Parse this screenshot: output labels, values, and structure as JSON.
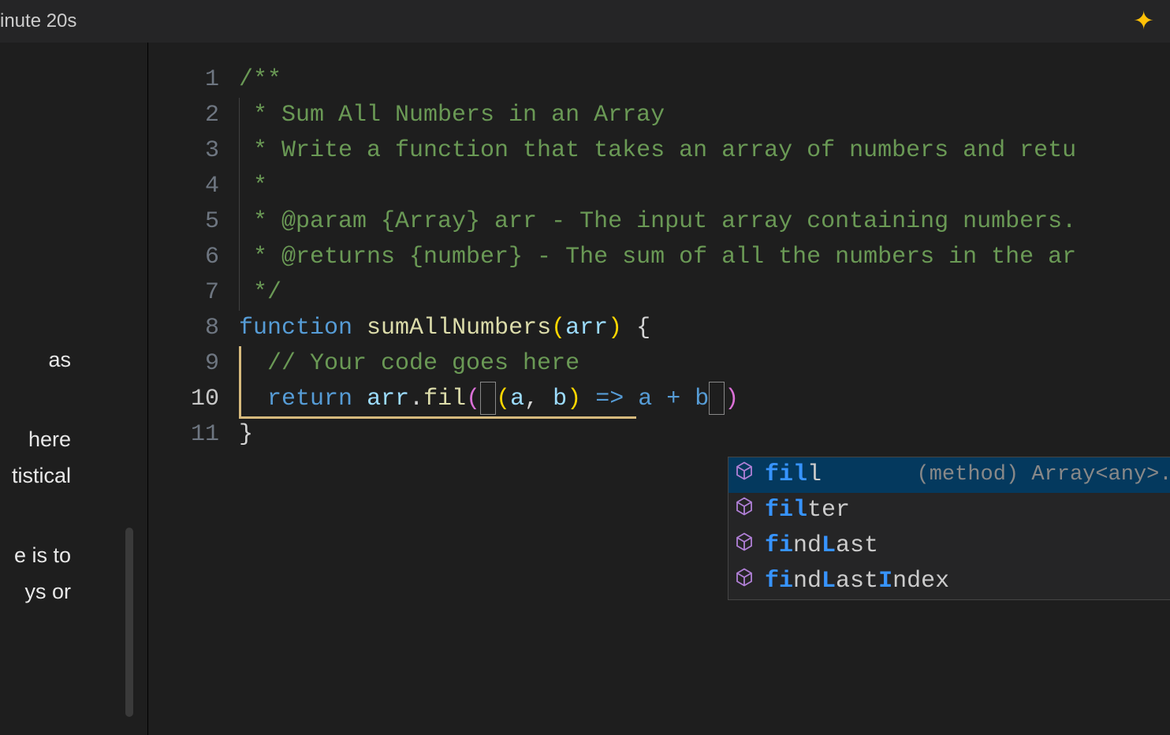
{
  "topbar": {
    "left_text": "inute 20s"
  },
  "left_panel": {
    "fragment1": "as",
    "fragment2": "here",
    "fragment3": "tistical",
    "fragment4": "e is to",
    "fragment5": "ys or"
  },
  "gutter": {
    "lines": [
      "1",
      "2",
      "3",
      "4",
      "5",
      "6",
      "7",
      "8",
      "9",
      "10",
      "11"
    ],
    "current_line": 10
  },
  "code": {
    "line1": "/**",
    "line2": " * Sum All Numbers in an Array",
    "line3": " * Write a function that takes an array of numbers and retu",
    "line4": " *",
    "line5": " * @param {Array} arr - The input array containing numbers.",
    "line6": " * @returns {number} - The sum of all the numbers in the ar",
    "line7": " */",
    "line8_kw": "function",
    "line8_fn": "sumAllNumbers",
    "line8_param": "arr",
    "line8_end": " {",
    "line9": "  // Your code goes here",
    "line10_kw": "return",
    "line10_obj": "arr",
    "line10_method": "fil",
    "line10_a": "a",
    "line10_b": "b",
    "line10_arrow_body": " => a + b",
    "line11": "}"
  },
  "autocomplete": {
    "items": [
      {
        "match": "fil",
        "rest": "l",
        "detail": "(method) Array<any>.fill(value:…"
      },
      {
        "match": "fil",
        "rest": "ter",
        "detail": ""
      },
      {
        "match_parts": [
          "fi",
          "L"
        ],
        "normal_parts": [
          "nd",
          "ast"
        ],
        "detail": ""
      },
      {
        "match_parts": [
          "fi",
          "L",
          "I"
        ],
        "normal_parts": [
          "nd",
          "ast",
          "ndex"
        ],
        "detail": ""
      }
    ]
  }
}
